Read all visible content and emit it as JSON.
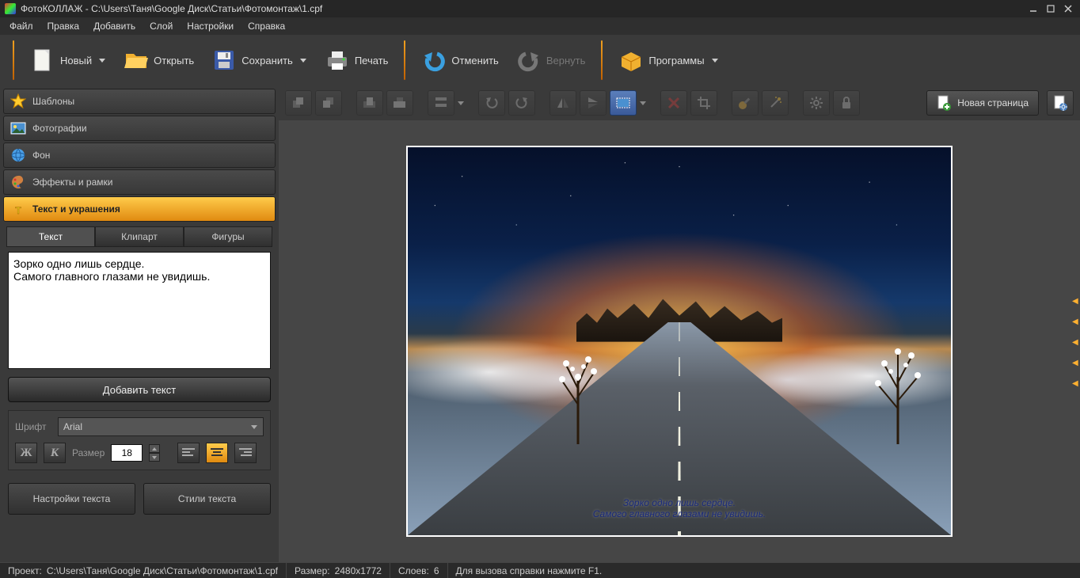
{
  "title": "ФотоКОЛЛАЖ - C:\\Users\\Таня\\Google Диск\\Статьи\\Фотомонтаж\\1.cpf",
  "menu": [
    "Файл",
    "Правка",
    "Добавить",
    "Слой",
    "Настройки",
    "Справка"
  ],
  "toolbar": {
    "new": "Новый",
    "open": "Открыть",
    "save": "Сохранить",
    "print": "Печать",
    "undo": "Отменить",
    "redo": "Вернуть",
    "programs": "Программы"
  },
  "accordion": {
    "templates": "Шаблоны",
    "photos": "Фотографии",
    "background": "Фон",
    "effects": "Эффекты и рамки",
    "text_deco": "Текст и украшения"
  },
  "text_panel": {
    "tabs": {
      "text": "Текст",
      "clipart": "Клипарт",
      "shapes": "Фигуры"
    },
    "content": "Зорко одно лишь сердце.\nСамого главного глазами не увидишь.",
    "add_text": "Добавить текст",
    "font_label": "Шрифт",
    "font_value": "Arial",
    "size_label": "Размер",
    "size_value": "18",
    "text_settings": "Настройки текста",
    "text_styles": "Стили текста"
  },
  "newpage": "Новая страница",
  "collage": {
    "line1": "Зорко одно лишь сердце.",
    "line2": "Самого главного глазами не увидишь."
  },
  "status": {
    "project_label": "Проект:",
    "project_value": "C:\\Users\\Таня\\Google Диск\\Статьи\\Фотомонтаж\\1.cpf",
    "size_label": "Размер:",
    "size_value": "2480x1772",
    "layers_label": "Слоев:",
    "layers_value": "6",
    "help": "Для вызова справки нажмите F1."
  }
}
